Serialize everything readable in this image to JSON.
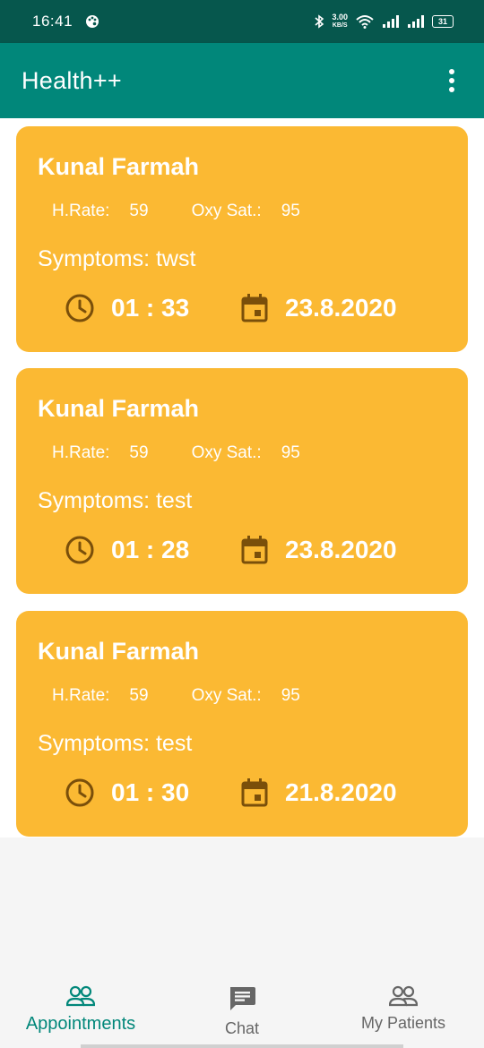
{
  "status_bar": {
    "time": "16:41",
    "net_speed": "3.00",
    "net_unit": "KB/S",
    "battery": "31"
  },
  "app_bar": {
    "title": "Health++"
  },
  "labels": {
    "heart_rate": "H.Rate:",
    "oxy_sat": "Oxy Sat.:"
  },
  "appointments": [
    {
      "name": "Kunal Farmah",
      "heart_rate": "59",
      "oxy_sat": "95",
      "symptoms": "Symptoms: twst",
      "time": "01 : 33",
      "date": "23.8.2020"
    },
    {
      "name": "Kunal Farmah",
      "heart_rate": "59",
      "oxy_sat": "95",
      "symptoms": "Symptoms: test",
      "time": "01 : 28",
      "date": "23.8.2020"
    },
    {
      "name": "Kunal Farmah",
      "heart_rate": "59",
      "oxy_sat": "95",
      "symptoms": "Symptoms: test",
      "time": "01 : 30",
      "date": "21.8.2020"
    }
  ],
  "bottom_nav": {
    "items": [
      {
        "label": "Appointments",
        "icon": "people-icon",
        "active": true
      },
      {
        "label": "Chat",
        "icon": "chat-icon",
        "active": false
      },
      {
        "label": "My Patients",
        "icon": "people-icon",
        "active": false
      }
    ]
  },
  "colors": {
    "status_bar": "#06574d",
    "app_bar": "#01877a",
    "card": "#fbb933",
    "card_icon": "#7a4f0a",
    "nav_active": "#01877a",
    "nav_inactive": "#666666"
  }
}
